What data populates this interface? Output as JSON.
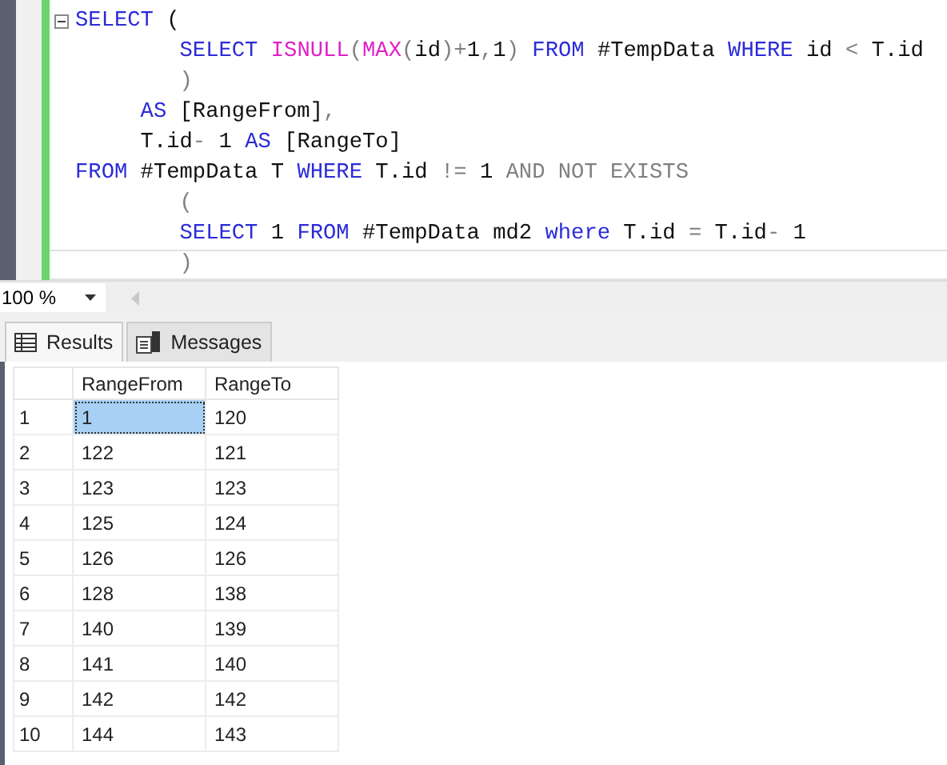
{
  "editor": {
    "lines": [
      {
        "collapsible": true,
        "tokens": [
          {
            "kind": "kw",
            "text": "SELECT"
          },
          {
            "kind": "txt",
            "text": " ("
          }
        ]
      },
      {
        "collapsible": false,
        "tokens": [
          {
            "kind": "kw",
            "text": "        SELECT "
          },
          {
            "kind": "fn",
            "text": "ISNULL"
          },
          {
            "kind": "op",
            "text": "("
          },
          {
            "kind": "fn",
            "text": "MAX"
          },
          {
            "kind": "op",
            "text": "("
          },
          {
            "kind": "txt",
            "text": "id"
          },
          {
            "kind": "op",
            "text": ")+"
          },
          {
            "kind": "txt",
            "text": "1"
          },
          {
            "kind": "op",
            "text": ","
          },
          {
            "kind": "txt",
            "text": "1"
          },
          {
            "kind": "op",
            "text": ") "
          },
          {
            "kind": "kw",
            "text": "FROM"
          },
          {
            "kind": "txt",
            "text": " #TempData "
          },
          {
            "kind": "kw",
            "text": "WHERE"
          },
          {
            "kind": "txt",
            "text": " id "
          },
          {
            "kind": "op",
            "text": "<"
          },
          {
            "kind": "txt",
            "text": " T.id"
          }
        ]
      },
      {
        "collapsible": false,
        "tokens": [
          {
            "kind": "op",
            "text": "        )"
          }
        ]
      },
      {
        "collapsible": false,
        "tokens": [
          {
            "kind": "kw",
            "text": "     AS"
          },
          {
            "kind": "txt",
            "text": " [RangeFrom]"
          },
          {
            "kind": "op",
            "text": ","
          }
        ]
      },
      {
        "collapsible": false,
        "tokens": [
          {
            "kind": "txt",
            "text": "     T.id"
          },
          {
            "kind": "op",
            "text": "-"
          },
          {
            "kind": "txt",
            "text": " 1 "
          },
          {
            "kind": "kw",
            "text": "AS"
          },
          {
            "kind": "txt",
            "text": " [RangeTo]"
          }
        ]
      },
      {
        "collapsible": false,
        "tokens": [
          {
            "kind": "kw",
            "text": "FROM"
          },
          {
            "kind": "txt",
            "text": " #TempData T "
          },
          {
            "kind": "kw",
            "text": "WHERE"
          },
          {
            "kind": "txt",
            "text": " T.id "
          },
          {
            "kind": "op",
            "text": "!="
          },
          {
            "kind": "txt",
            "text": " 1 "
          },
          {
            "kind": "op",
            "text": "AND NOT EXISTS"
          }
        ]
      },
      {
        "collapsible": false,
        "tokens": [
          {
            "kind": "op",
            "text": "        ("
          }
        ]
      },
      {
        "collapsible": false,
        "tokens": [
          {
            "kind": "kw",
            "text": "        SELECT"
          },
          {
            "kind": "txt",
            "text": " 1 "
          },
          {
            "kind": "kw",
            "text": "FROM"
          },
          {
            "kind": "txt",
            "text": " #TempData md2 "
          },
          {
            "kind": "kw",
            "text": "where"
          },
          {
            "kind": "txt",
            "text": " T.id "
          },
          {
            "kind": "op",
            "text": "="
          },
          {
            "kind": "txt",
            "text": " T.id"
          },
          {
            "kind": "op",
            "text": "-"
          },
          {
            "kind": "txt",
            "text": " 1"
          }
        ]
      },
      {
        "collapsible": false,
        "tokens": [
          {
            "kind": "op",
            "text": "        )"
          }
        ]
      }
    ]
  },
  "zoom": {
    "value": "100 %"
  },
  "tabs": [
    {
      "label": "Results",
      "selected": true
    },
    {
      "label": "Messages",
      "selected": false
    }
  ],
  "grid": {
    "columns": [
      "RangeFrom",
      "RangeTo"
    ],
    "rows": [
      {
        "number": "1",
        "cells": [
          {
            "text": "1",
            "selected": true
          },
          {
            "text": "120",
            "selected": false
          }
        ]
      },
      {
        "number": "2",
        "cells": [
          {
            "text": "122",
            "selected": false
          },
          {
            "text": "121",
            "selected": false
          }
        ]
      },
      {
        "number": "3",
        "cells": [
          {
            "text": "123",
            "selected": false
          },
          {
            "text": "123",
            "selected": false
          }
        ]
      },
      {
        "number": "4",
        "cells": [
          {
            "text": "125",
            "selected": false
          },
          {
            "text": "124",
            "selected": false
          }
        ]
      },
      {
        "number": "5",
        "cells": [
          {
            "text": "126",
            "selected": false
          },
          {
            "text": "126",
            "selected": false
          }
        ]
      },
      {
        "number": "6",
        "cells": [
          {
            "text": "128",
            "selected": false
          },
          {
            "text": "138",
            "selected": false
          }
        ]
      },
      {
        "number": "7",
        "cells": [
          {
            "text": "140",
            "selected": false
          },
          {
            "text": "139",
            "selected": false
          }
        ]
      },
      {
        "number": "8",
        "cells": [
          {
            "text": "141",
            "selected": false
          },
          {
            "text": "140",
            "selected": false
          }
        ]
      },
      {
        "number": "9",
        "cells": [
          {
            "text": "142",
            "selected": false
          },
          {
            "text": "142",
            "selected": false
          }
        ]
      },
      {
        "number": "10",
        "cells": [
          {
            "text": "144",
            "selected": false
          },
          {
            "text": "143",
            "selected": false
          }
        ]
      }
    ]
  }
}
